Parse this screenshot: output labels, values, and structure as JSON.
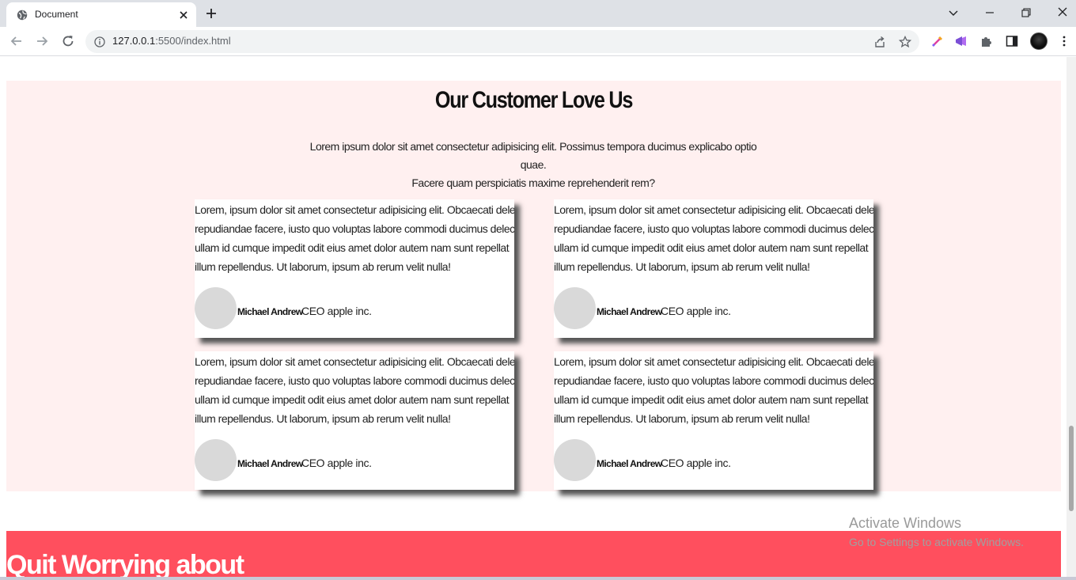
{
  "browser": {
    "tab_title": "Document",
    "url_host": "127.0.0.1",
    "url_rest": ":5500/index.html"
  },
  "testimonials": {
    "title": "Our Customer Love Us",
    "subtitle_line1": "Lorem ipsum dolor sit amet consectetur adipisicing elit. Possimus tempora ducimus explicabo optio quae.",
    "subtitle_line2": "Facere quam perspiciatis maxime reprehenderit rem?",
    "cards": [
      {
        "text_lines": [
          "Lorem, ipsum dolor sit amet consectetur adipisicing elit. Obcaecati deleniti",
          "repudiandae facere, iusto quo voluptas labore commodi ducimus delectus",
          "ullam id cumque impedit odit eius amet dolor autem nam sunt repellat",
          "illum repellendus. Ut laborum, ipsum ab rerum velit nulla!"
        ],
        "name": "Michael Andrew",
        "role": "CEO apple inc."
      },
      {
        "text_lines": [
          "Lorem, ipsum dolor sit amet consectetur adipisicing elit. Obcaecati deleniti",
          "repudiandae facere, iusto quo voluptas labore commodi ducimus delectus",
          "ullam id cumque impedit odit eius amet dolor autem nam sunt repellat",
          "illum repellendus. Ut laborum, ipsum ab rerum velit nulla!"
        ],
        "name": "Michael Andrew",
        "role": "CEO apple inc."
      },
      {
        "text_lines": [
          "Lorem, ipsum dolor sit amet consectetur adipisicing elit. Obcaecati deleniti",
          "repudiandae facere, iusto quo voluptas labore commodi ducimus delectus",
          "ullam id cumque impedit odit eius amet dolor autem nam sunt repellat",
          "illum repellendus. Ut laborum, ipsum ab rerum velit nulla!"
        ],
        "name": "Michael Andrew",
        "role": "CEO apple inc."
      },
      {
        "text_lines": [
          "Lorem, ipsum dolor sit amet consectetur adipisicing elit. Obcaecati deleniti",
          "repudiandae facere, iusto quo voluptas labore commodi ducimus delectus",
          "ullam id cumque impedit odit eius amet dolor autem nam sunt repellat",
          "illum repellendus. Ut laborum, ipsum ab rerum velit nulla!"
        ],
        "name": "Michael Andrew",
        "role": "CEO apple inc."
      }
    ]
  },
  "promo": {
    "title": "Quit Worrying about"
  },
  "watermark": {
    "title": "Activate Windows",
    "subtitle": "Go to Settings to activate Windows."
  },
  "colors": {
    "section_bg": "#fff0f0",
    "promo_bg": "#ff4f5e",
    "avatar_placeholder": "#d9d9d9"
  },
  "icons": {
    "tab": [
      "globe-icon",
      "close-icon",
      "plus-icon"
    ],
    "window": [
      "chevron-down-icon",
      "minimize-icon",
      "restore-icon",
      "close-window-icon"
    ],
    "nav": [
      "back-arrow-icon",
      "forward-arrow-icon",
      "reload-icon",
      "info-icon"
    ],
    "toolbar": [
      "share-icon",
      "star-icon",
      "color-picker-extension-icon",
      "megaphone-extension-icon",
      "puzzle-extensions-icon",
      "side-panel-icon",
      "kebab-menu-icon"
    ]
  }
}
